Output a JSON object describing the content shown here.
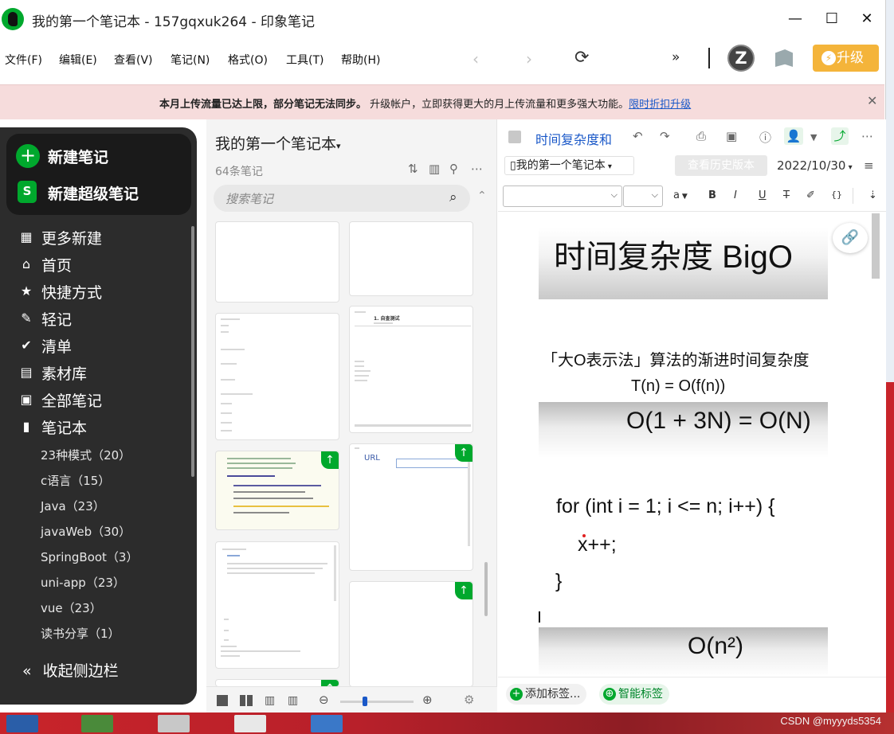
{
  "window": {
    "title": "我的第一个笔记本 - 157gqxuk264 - 印象笔记",
    "minimize": "—",
    "maximize": "☐",
    "close": "✕"
  },
  "menu": [
    "文件(F)",
    "编辑(E)",
    "查看(V)",
    "笔记(N)",
    "格式(O)",
    "工具(T)",
    "帮助(H)"
  ],
  "toolbar": {
    "avatar_letter": "Z",
    "upgrade_label": "升级",
    "more": "»"
  },
  "banner": {
    "bold_text": "本月上传流量已达上限，部分笔记无法同步。",
    "text": "升级帐户，立即获得更大的月上传流量和更多强大功能。",
    "link": "限时折扣升级",
    "close": "✕"
  },
  "sidebar": {
    "new_note": "新建笔记",
    "new_super_note": "新建超级笔记",
    "items": [
      "更多新建",
      "首页",
      "快捷方式",
      "轻记",
      "清单",
      "素材库",
      "全部笔记",
      "笔记本"
    ],
    "notebooks": [
      "23种模式（20）",
      "c语言（15）",
      "Java（23）",
      "javaWeb（30）",
      "SpringBoot（3）",
      "uni-app（23）",
      "vue（23）",
      "读书分享（1）"
    ],
    "collapse": "收起侧边栏",
    "collapse_icon": "«"
  },
  "notelist": {
    "notebook_title": "我的第一个笔记本",
    "count": "64条笔记",
    "search_placeholder": "搜索笔记",
    "card_heading": "1. 自查测试",
    "card_url": "URL"
  },
  "editor": {
    "title": "时间复杂度和",
    "notebook": "我的第一个笔记本",
    "history_btn": "查看历史版本",
    "date": "2022/10/30",
    "heading": "时间复杂度 BigO",
    "line1": "「大O表示法」算法的渐进时间复杂度",
    "line2": "T(n) = O(f(n))",
    "box2": "O(1 + 3N) = O(N)",
    "code1": "for (int i = 1; i <= n; i++) {",
    "code2": "x++;",
    "code3": "}",
    "box3": "O(n²)",
    "add_tag": "添加标签...",
    "smart_tag": "智能标签",
    "font_color": "a"
  },
  "taskbar": {
    "watermark": "CSDN @myyyds5354"
  },
  "colors": {
    "brand_green": "#00a82d",
    "upgrade_orange": "#f4b43a",
    "banner_bg": "#f6dcdc",
    "link_blue": "#1a58c8",
    "sidebar_bg": "#2c2c2c"
  }
}
